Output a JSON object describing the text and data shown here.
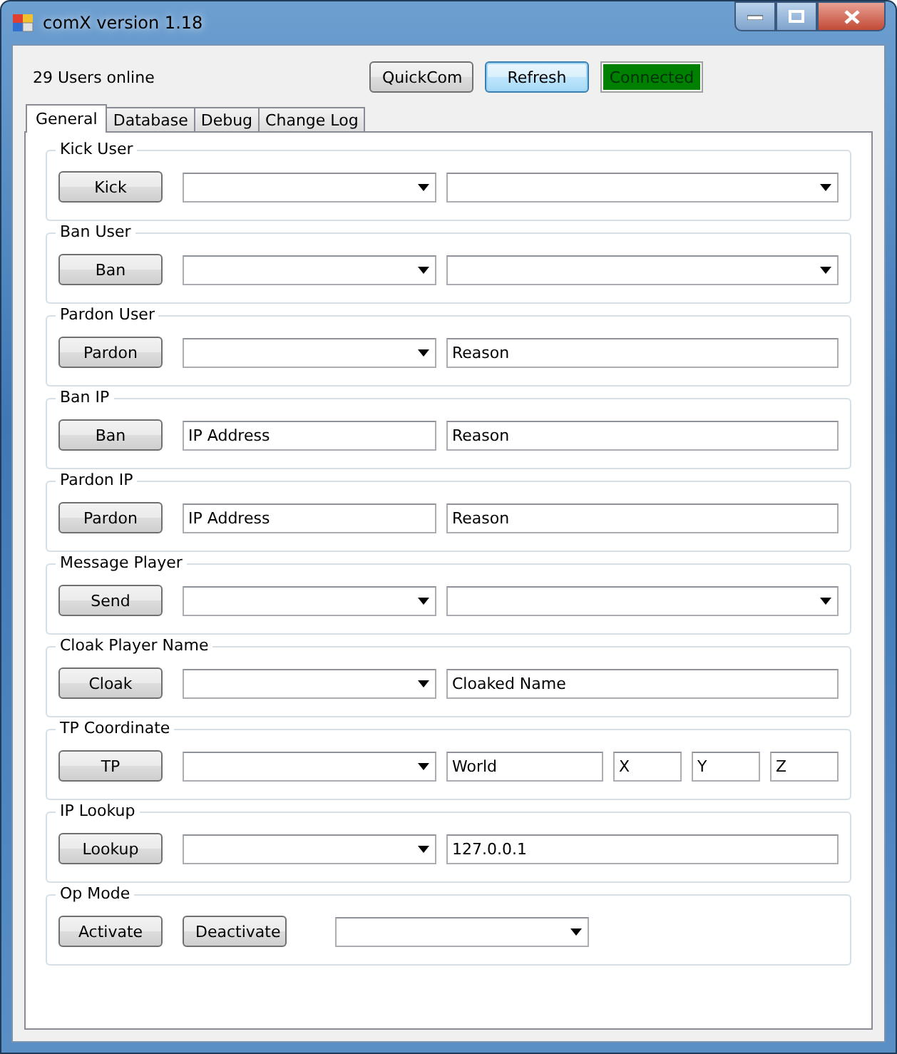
{
  "window": {
    "title": "comX version 1.18"
  },
  "users_online": "29 Users online",
  "top_buttons": [
    {
      "label": "QuickCom",
      "focused": false
    },
    {
      "label": "Refresh",
      "focused": true
    }
  ],
  "status": {
    "text": "Connected"
  },
  "tabs": [
    {
      "label": "General",
      "selected": true
    },
    {
      "label": "Database",
      "selected": false
    },
    {
      "label": "Debug",
      "selected": false
    },
    {
      "label": "Change Log",
      "selected": false
    }
  ],
  "groups": [
    {
      "title": "Kick User",
      "buttons": [
        "Kick"
      ],
      "fields": [
        {
          "kind": "combo"
        },
        {
          "kind": "combo"
        }
      ]
    },
    {
      "title": "Ban User",
      "buttons": [
        "Ban"
      ],
      "fields": [
        {
          "kind": "combo"
        },
        {
          "kind": "combo"
        }
      ]
    },
    {
      "title": "Pardon User",
      "buttons": [
        "Pardon"
      ],
      "fields": [
        {
          "kind": "combo"
        },
        {
          "kind": "text",
          "value": "Reason"
        }
      ]
    },
    {
      "title": "Ban IP",
      "buttons": [
        "Ban"
      ],
      "fields": [
        {
          "kind": "text",
          "value": "IP Address"
        },
        {
          "kind": "text",
          "value": "Reason"
        }
      ]
    },
    {
      "title": "Pardon IP",
      "buttons": [
        "Pardon"
      ],
      "fields": [
        {
          "kind": "text",
          "value": "IP Address"
        },
        {
          "kind": "text",
          "value": "Reason"
        }
      ]
    },
    {
      "title": "Message Player",
      "buttons": [
        "Send"
      ],
      "fields": [
        {
          "kind": "combo"
        },
        {
          "kind": "combo"
        }
      ]
    },
    {
      "title": "Cloak Player Name",
      "buttons": [
        "Cloak"
      ],
      "fields": [
        {
          "kind": "combo"
        },
        {
          "kind": "text",
          "value": "Cloaked Name"
        }
      ]
    },
    {
      "title": "TP Coordinate",
      "buttons": [
        "TP"
      ],
      "fields": [
        {
          "kind": "combo"
        },
        {
          "kind": "text",
          "value": "World"
        },
        {
          "kind": "coord",
          "value": "X"
        },
        {
          "kind": "coord",
          "value": "Y"
        },
        {
          "kind": "coord",
          "value": "Z"
        }
      ]
    },
    {
      "title": "IP Lookup",
      "buttons": [
        "Lookup"
      ],
      "fields": [
        {
          "kind": "combo"
        },
        {
          "kind": "text",
          "value": "127.0.0.1"
        }
      ]
    },
    {
      "title": "Op Mode",
      "buttons": [
        "Activate",
        "Deactivate"
      ],
      "fields": [
        {
          "kind": "combo"
        }
      ]
    }
  ]
}
